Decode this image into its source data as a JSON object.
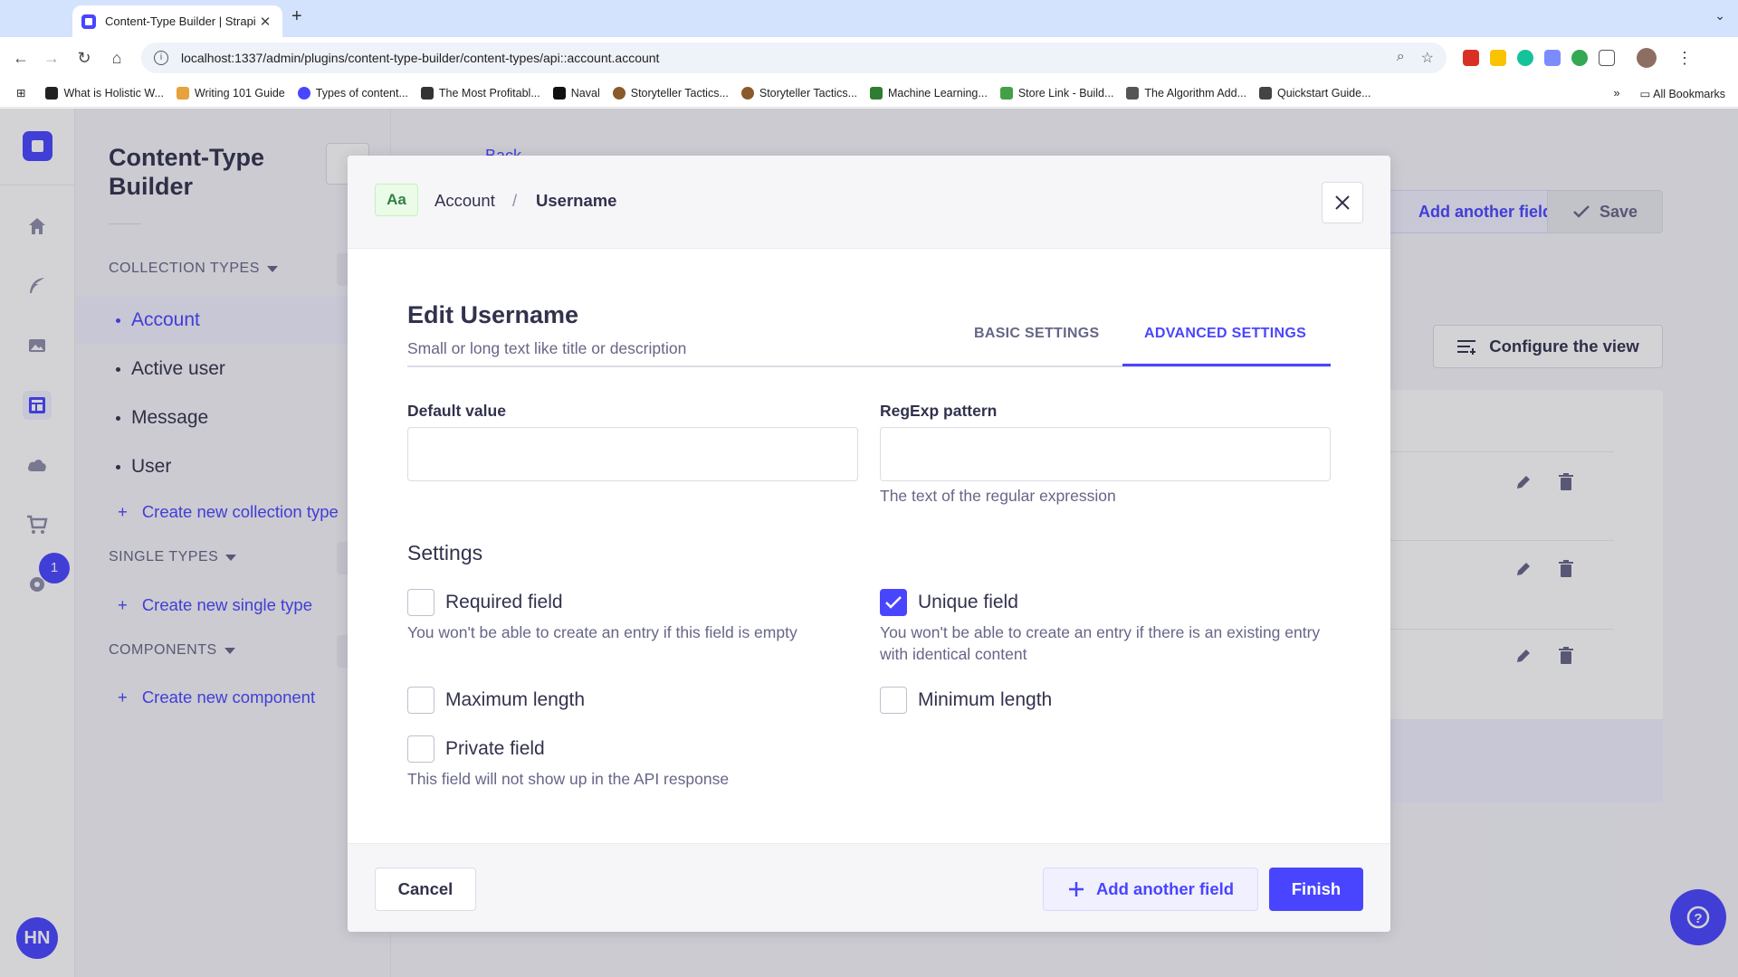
{
  "browser": {
    "tab_title": "Content-Type Builder | Strapi",
    "url": "localhost:1337/admin/plugins/content-type-builder/content-types/api::account.account",
    "bookmarks": [
      {
        "label": "What is Holistic W...",
        "color": "#222222"
      },
      {
        "label": "Writing 101 Guide",
        "color": "#e6a23c"
      },
      {
        "label": "Types of content...",
        "color": "#4945ff"
      },
      {
        "label": "The Most Profitabl...",
        "color": "#333333"
      },
      {
        "label": "Naval",
        "color": "#111111"
      },
      {
        "label": "Storyteller Tactics...",
        "color": "#8b5a2b"
      },
      {
        "label": "Storyteller Tactics...",
        "color": "#8b5a2b"
      },
      {
        "label": "Machine Learning...",
        "color": "#2e7d32"
      },
      {
        "label": "Store Link - Build...",
        "color": "#43a047"
      },
      {
        "label": "The Algorithm Add...",
        "color": "#555555"
      },
      {
        "label": "Quickstart Guide...",
        "color": "#444444"
      }
    ],
    "all_bookmarks": "All Bookmarks",
    "overflow": "»"
  },
  "app": {
    "nav_badge": "1",
    "avatar_initials": "HN"
  },
  "sidebar": {
    "title": "Content-Type Builder",
    "collection_types_header": "COLLECTION TYPES",
    "collection_types": [
      "Account",
      "Active user",
      "Message",
      "User"
    ],
    "active_item": "Account",
    "create_collection": "Create new collection type",
    "single_types_header": "SINGLE TYPES",
    "create_single": "Create new single type",
    "components_header": "COMPONENTS",
    "create_component": "Create new component"
  },
  "content": {
    "back": "Back",
    "add_another_field": "Add another field",
    "save": "Save",
    "configure_view": "Configure the view"
  },
  "modal": {
    "type_chip": "Aa",
    "breadcrumb": {
      "parent": "Account",
      "separator": "/",
      "current": "Username"
    },
    "title": "Edit Username",
    "subtitle": "Small or long text like title or description",
    "tabs": {
      "basic": "BASIC SETTINGS",
      "advanced": "ADVANCED SETTINGS",
      "active": "advanced"
    },
    "default_value": {
      "label": "Default value",
      "value": ""
    },
    "regexp": {
      "label": "RegExp pattern",
      "value": "",
      "hint": "The text of the regular expression"
    },
    "settings_title": "Settings",
    "checkboxes": {
      "required": {
        "label": "Required field",
        "checked": false,
        "hint": "You won't be able to create an entry if this field is empty"
      },
      "unique": {
        "label": "Unique field",
        "checked": true,
        "hint": "You won't be able to create an entry if there is an existing entry with identical content"
      },
      "max_length": {
        "label": "Maximum length",
        "checked": false
      },
      "min_length": {
        "label": "Minimum length",
        "checked": false
      },
      "private": {
        "label": "Private field",
        "checked": false,
        "hint": "This field will not show up in the API response"
      }
    },
    "footer": {
      "cancel": "Cancel",
      "add_another": "Add another field",
      "finish": "Finish"
    }
  },
  "colors": {
    "primary": "#4945ff",
    "text": "#32324d",
    "muted": "#666687"
  }
}
